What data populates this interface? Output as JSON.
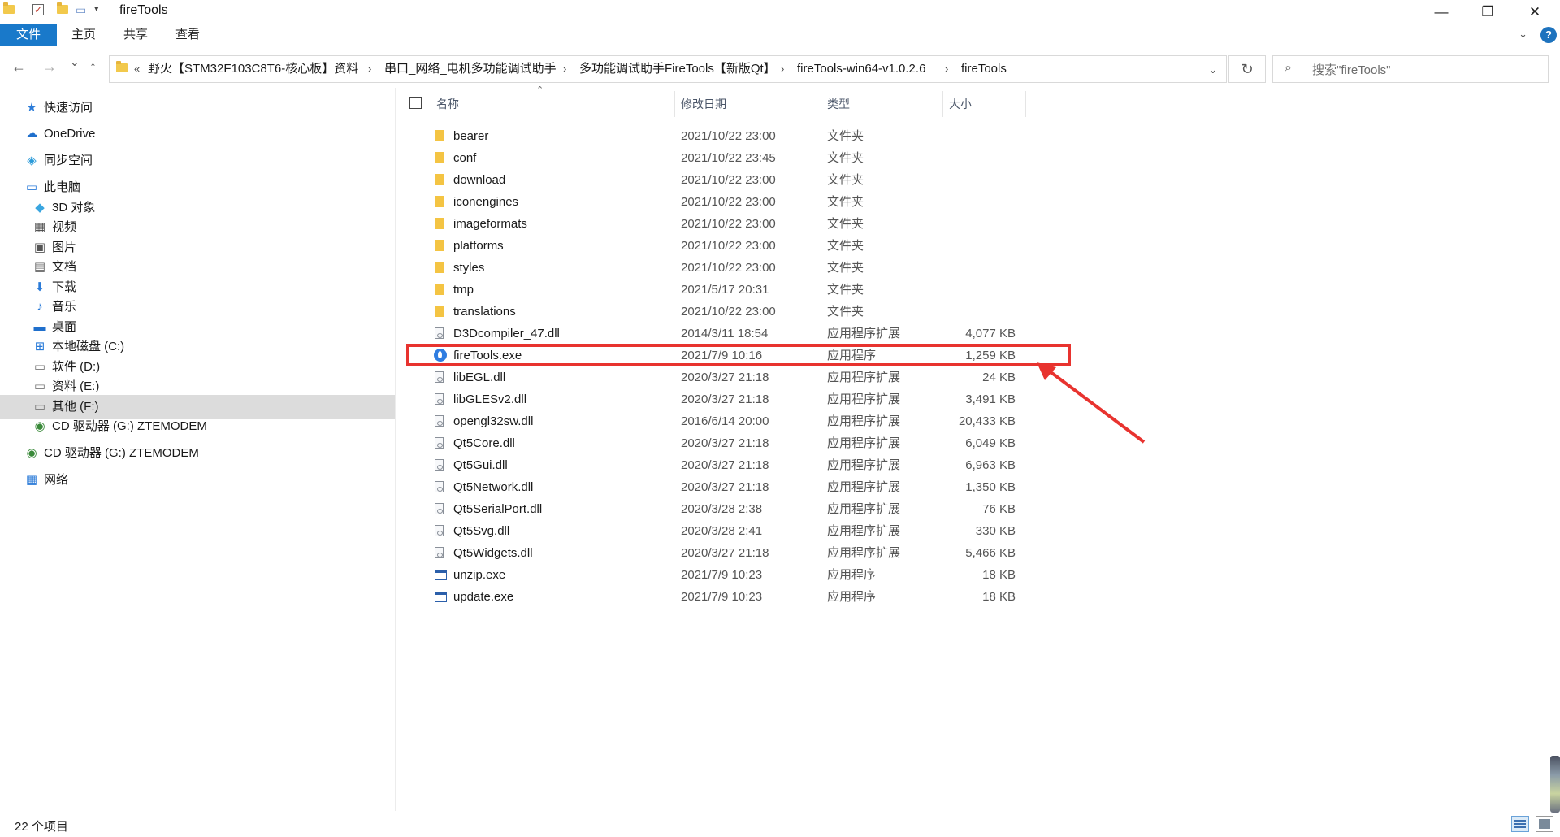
{
  "window": {
    "title": "fireTools",
    "controls": {
      "minimize": "—",
      "maximize": "❐",
      "close": "✕"
    }
  },
  "ribbon": {
    "tabs": [
      {
        "label": "文件",
        "active": true
      },
      {
        "label": "主页",
        "active": false
      },
      {
        "label": "共享",
        "active": false
      },
      {
        "label": "查看",
        "active": false
      }
    ],
    "help": "?"
  },
  "navigation": {
    "back": "←",
    "forward": "→",
    "recent": "⌄",
    "up": "↑",
    "overflow": "«",
    "breadcrumbs": [
      "野火【STM32F103C8T6-核心板】资料",
      "串口_网络_电机多功能调试助手",
      "多功能调试助手FireTools【新版Qt】",
      "fireTools-win64-v1.0.2.6",
      "fireTools"
    ],
    "refresh": "↻",
    "search_placeholder": "搜索\"fireTools\""
  },
  "sidebar": {
    "items": [
      {
        "label": "快速访问",
        "icon": "star-icon",
        "glyph": "★",
        "color": "#2b7bd8"
      },
      {
        "label": "OneDrive",
        "icon": "cloud-icon",
        "glyph": "☁",
        "color": "#1f6fcc"
      },
      {
        "label": "同步空间",
        "icon": "sync-icon",
        "glyph": "◈",
        "color": "#2a9ad9"
      },
      {
        "label": "此电脑",
        "icon": "computer-icon",
        "glyph": "▭",
        "color": "#2b7bd8"
      },
      {
        "label": "3D 对象",
        "icon": "cube-icon",
        "glyph": "◆",
        "color": "#3aa6e0"
      },
      {
        "label": "视频",
        "icon": "film-icon",
        "glyph": "▦",
        "color": "#444444"
      },
      {
        "label": "图片",
        "icon": "picture-icon",
        "glyph": "▣",
        "color": "#555555"
      },
      {
        "label": "文档",
        "icon": "document-icon",
        "glyph": "▤",
        "color": "#666666"
      },
      {
        "label": "下载",
        "icon": "download-icon",
        "glyph": "⬇",
        "color": "#2b7bd8"
      },
      {
        "label": "音乐",
        "icon": "music-icon",
        "glyph": "♪",
        "color": "#2b7bd8"
      },
      {
        "label": "桌面",
        "icon": "desktop-icon",
        "glyph": "▬",
        "color": "#1f6fcc"
      },
      {
        "label": "本地磁盘 (C:)",
        "icon": "windows-drive-icon",
        "glyph": "⊞",
        "color": "#2b7bd8"
      },
      {
        "label": "软件 (D:)",
        "icon": "drive-icon",
        "glyph": "▭",
        "color": "#777777"
      },
      {
        "label": "资料 (E:)",
        "icon": "drive-icon",
        "glyph": "▭",
        "color": "#777777"
      },
      {
        "label": "其他 (F:)",
        "icon": "drive-icon",
        "glyph": "▭",
        "color": "#777777",
        "selected": true
      },
      {
        "label": "CD 驱动器 (G:) ZTEMODEM",
        "icon": "cd-drive-icon",
        "glyph": "◉",
        "color": "#3a8a3a"
      },
      {
        "label": "CD 驱动器 (G:) ZTEMODEM",
        "icon": "cd-drive-icon",
        "glyph": "◉",
        "color": "#3a8a3a"
      },
      {
        "label": "网络",
        "icon": "network-icon",
        "glyph": "▦",
        "color": "#2b7bd8"
      }
    ]
  },
  "columns": {
    "name": "名称",
    "date": "修改日期",
    "type": "类型",
    "size": "大小"
  },
  "files": [
    {
      "name": "bearer",
      "date": "2021/10/22 23:00",
      "type": "文件夹",
      "size": "",
      "kind": "folder"
    },
    {
      "name": "conf",
      "date": "2021/10/22 23:45",
      "type": "文件夹",
      "size": "",
      "kind": "folder"
    },
    {
      "name": "download",
      "date": "2021/10/22 23:00",
      "type": "文件夹",
      "size": "",
      "kind": "folder"
    },
    {
      "name": "iconengines",
      "date": "2021/10/22 23:00",
      "type": "文件夹",
      "size": "",
      "kind": "folder"
    },
    {
      "name": "imageformats",
      "date": "2021/10/22 23:00",
      "type": "文件夹",
      "size": "",
      "kind": "folder"
    },
    {
      "name": "platforms",
      "date": "2021/10/22 23:00",
      "type": "文件夹",
      "size": "",
      "kind": "folder"
    },
    {
      "name": "styles",
      "date": "2021/10/22 23:00",
      "type": "文件夹",
      "size": "",
      "kind": "folder"
    },
    {
      "name": "tmp",
      "date": "2021/5/17 20:31",
      "type": "文件夹",
      "size": "",
      "kind": "folder"
    },
    {
      "name": "translations",
      "date": "2021/10/22 23:00",
      "type": "文件夹",
      "size": "",
      "kind": "folder"
    },
    {
      "name": "D3Dcompiler_47.dll",
      "date": "2014/3/11 18:54",
      "type": "应用程序扩展",
      "size": "4,077 KB",
      "kind": "dll"
    },
    {
      "name": "fireTools.exe",
      "date": "2021/7/9 10:16",
      "type": "应用程序",
      "size": "1,259 KB",
      "kind": "fire"
    },
    {
      "name": "libEGL.dll",
      "date": "2020/3/27 21:18",
      "type": "应用程序扩展",
      "size": "24 KB",
      "kind": "dll"
    },
    {
      "name": "libGLESv2.dll",
      "date": "2020/3/27 21:18",
      "type": "应用程序扩展",
      "size": "3,491 KB",
      "kind": "dll"
    },
    {
      "name": "opengl32sw.dll",
      "date": "2016/6/14 20:00",
      "type": "应用程序扩展",
      "size": "20,433 KB",
      "kind": "dll"
    },
    {
      "name": "Qt5Core.dll",
      "date": "2020/3/27 21:18",
      "type": "应用程序扩展",
      "size": "6,049 KB",
      "kind": "dll"
    },
    {
      "name": "Qt5Gui.dll",
      "date": "2020/3/27 21:18",
      "type": "应用程序扩展",
      "size": "6,963 KB",
      "kind": "dll"
    },
    {
      "name": "Qt5Network.dll",
      "date": "2020/3/27 21:18",
      "type": "应用程序扩展",
      "size": "1,350 KB",
      "kind": "dll"
    },
    {
      "name": "Qt5SerialPort.dll",
      "date": "2020/3/28 2:38",
      "type": "应用程序扩展",
      "size": "76 KB",
      "kind": "dll"
    },
    {
      "name": "Qt5Svg.dll",
      "date": "2020/3/28 2:41",
      "type": "应用程序扩展",
      "size": "330 KB",
      "kind": "dll"
    },
    {
      "name": "Qt5Widgets.dll",
      "date": "2020/3/27 21:18",
      "type": "应用程序扩展",
      "size": "5,466 KB",
      "kind": "dll"
    },
    {
      "name": "unzip.exe",
      "date": "2021/7/9 10:23",
      "type": "应用程序",
      "size": "18 KB",
      "kind": "exe"
    },
    {
      "name": "update.exe",
      "date": "2021/7/9 10:23",
      "type": "应用程序",
      "size": "18 KB",
      "kind": "exe"
    }
  ],
  "annotation": {
    "highlight_color": "#e8332f",
    "highlighted_file": "fireTools.exe"
  },
  "status": {
    "item_count": "22 个项目"
  },
  "colors": {
    "accent": "#1979ca",
    "selection": "#dcdcdc"
  }
}
